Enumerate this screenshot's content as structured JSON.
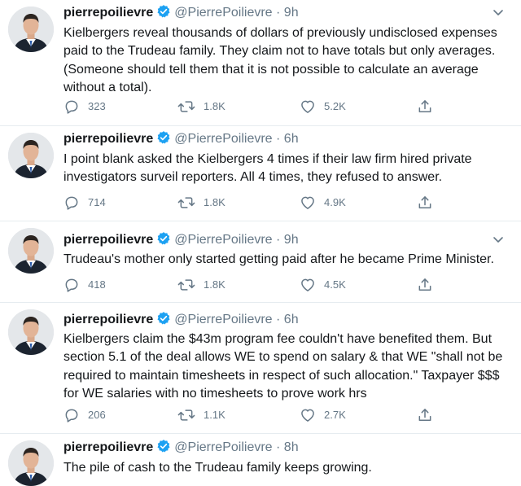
{
  "tweets": [
    {
      "name": "pierrepoilievre",
      "handle": "@PierrePoilievre",
      "sep": "·",
      "time": "9h",
      "text": "Kielbergers reveal thousands of dollars of previously undisclosed expenses paid to the Trudeau family. They claim not to have totals but only averages. (Someone should tell them that it is not possible to calculate an average without a total).",
      "replies": "323",
      "retweets": "1.8K",
      "likes": "5.2K"
    },
    {
      "name": "pierrepoilievre",
      "handle": "@PierrePoilievre",
      "sep": "·",
      "time": "6h",
      "text": "I point blank asked the Kielbergers 4 times if their law firm hired private investigators surveil reporters. All 4 times, they refused to answer.",
      "replies": "714",
      "retweets": "1.8K",
      "likes": "4.9K"
    },
    {
      "name": "pierrepoilievre",
      "handle": "@PierrePoilievre",
      "sep": "·",
      "time": "9h",
      "text": "Trudeau's mother only started getting paid after he became Prime Minister.",
      "replies": "418",
      "retweets": "1.8K",
      "likes": "4.5K"
    },
    {
      "name": "pierrepoilievre",
      "handle": "@PierrePoilievre",
      "sep": "·",
      "time": "6h",
      "text": "Kielbergers claim the $43m program fee couldn't have benefited them. But section 5.1 of the deal allows WE to spend on salary & that WE \"shall not be required to maintain timesheets in respect of such allocation.\" Taxpayer $$$ for WE salaries with no timesheets to prove work hrs",
      "replies": "206",
      "retweets": "1.1K",
      "likes": "2.7K"
    },
    {
      "name": "pierrepoilievre",
      "handle": "@PierrePoilievre",
      "sep": "·",
      "time": "8h",
      "text": "The pile of cash to the Trudeau family keeps growing."
    }
  ],
  "icons": {
    "reply": "reply-icon",
    "retweet": "retweet-icon",
    "like": "like-icon",
    "share": "share-icon",
    "verified": "verified-badge-icon",
    "menu": "chevron-down-icon"
  },
  "colors": {
    "text": "#14171a",
    "muted": "#657786",
    "verified": "#1da1f2",
    "divider": "#e6ecf0"
  }
}
